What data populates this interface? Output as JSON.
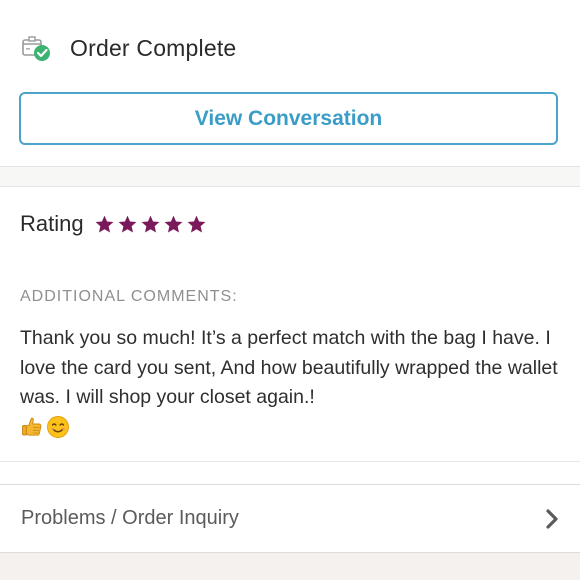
{
  "order": {
    "status_title": "Order Complete",
    "icon": "package-check-icon",
    "check_color": "#3cb371"
  },
  "actions": {
    "view_conversation_label": "View Conversation",
    "button_color": "#3b9cc7"
  },
  "rating": {
    "label": "Rating",
    "stars": 5,
    "max_stars": 5,
    "star_color": "#7a1a5a"
  },
  "comments": {
    "heading": "ADDITIONAL COMMENTS:",
    "body": "Thank you so much! It’s a perfect match with the bag I have. I love the card you sent, And how beautifully wrapped the wallet was. I will shop your closet again.!",
    "emojis": [
      "thumbs-up-icon",
      "smiling-face-icon"
    ]
  },
  "problems": {
    "label": "Problems / Order Inquiry",
    "icon": "chevron-right-icon"
  }
}
